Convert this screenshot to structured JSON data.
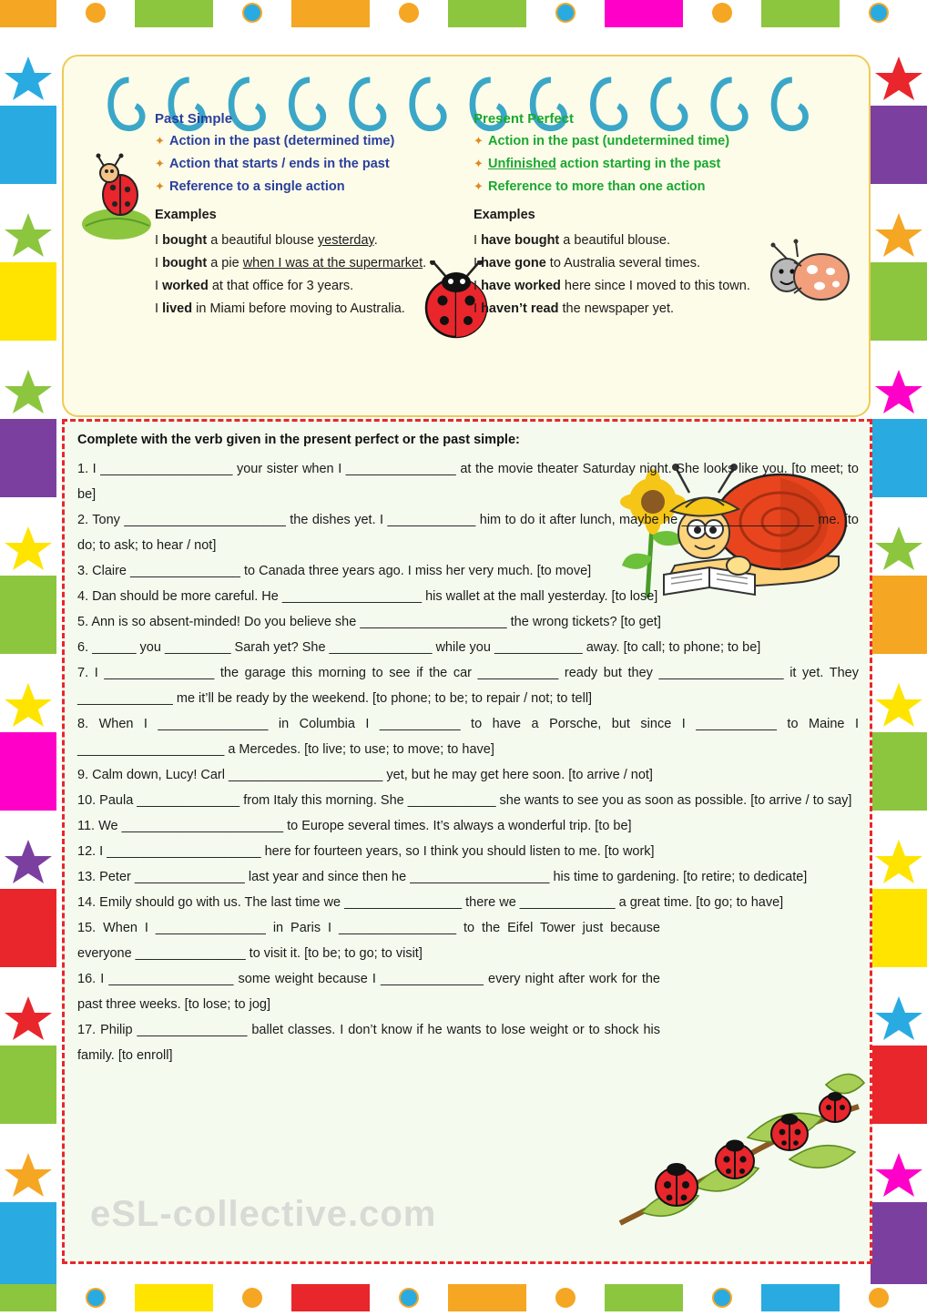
{
  "grammar": {
    "left": {
      "title": "Past Simple",
      "bullets": [
        "Action in the past (determined time)",
        "Action that starts / ends in the past",
        "Reference to a single action"
      ],
      "examples_title": "Examples",
      "examples": [
        {
          "pre": "I ",
          "bold": "bought",
          "post": " a beautiful blouse ",
          "underline": "yesterday",
          "tail": "."
        },
        {
          "pre": "I ",
          "bold": "bought",
          "post": " a pie ",
          "underline": "when I was at the supermarket",
          "tail": "."
        },
        {
          "pre": "I ",
          "bold": "worked",
          "post": " at that office for 3 years.",
          "underline": "",
          "tail": ""
        },
        {
          "pre": "I ",
          "bold": "lived",
          "post": " in Miami before moving to Australia.",
          "underline": "",
          "tail": ""
        }
      ]
    },
    "right": {
      "title": "Present Perfect",
      "bullets": [
        {
          "pre": "",
          "u": "",
          "post": "Action in the past (undetermined time)"
        },
        {
          "pre": "",
          "u": "Unfinished",
          "post": " action starting in the past"
        },
        {
          "pre": "",
          "u": "",
          "post": "Reference to more than one action"
        }
      ],
      "examples_title": "Examples",
      "examples": [
        {
          "pre": "I ",
          "bold": "have bought",
          "post": " a beautiful blouse."
        },
        {
          "pre": "I ",
          "bold": "have gone",
          "post": " to Australia several times."
        },
        {
          "pre": "I ",
          "bold": "have worked",
          "post": " here since I moved to this town."
        },
        {
          "pre": "I ",
          "bold": "haven’t read",
          "post": " the newspaper yet."
        }
      ]
    }
  },
  "exercise": {
    "instruction": "Complete with the verb given in the present perfect or the past simple:",
    "items": [
      "1. I __________________ your sister when I _______________ at the movie theater Saturday night. She looks like you. [to meet; to be]",
      "2. Tony ______________________ the dishes yet. I ____________ him to do it after lunch, maybe he __________________ me. [to do; to ask; to hear / not]",
      "3. Claire _______________ to Canada three years ago. I miss her very much. [to move]",
      "4. Dan should be more careful. He ___________________ his wallet at the mall yesterday. [to lose]",
      "5. Ann is so absent-minded! Do you believe she ____________________ the wrong tickets? [to get]",
      "6. ______ you _________ Sarah yet? She ______________ while you ____________ away. [to call; to phone; to be]",
      "7. I _______________ the garage this morning to see if the car ___________ ready but they _________________ it yet. They _____________ me it’ll be ready by the weekend. [to phone; to be; to repair / not; to tell]",
      "8. When I _______________ in Columbia I ___________ to have a Porsche, but since I ___________ to Maine I ____________________ a Mercedes. [to live; to use; to move; to have]",
      "9. Calm down, Lucy! Carl _____________________ yet, but he may get here soon. [to arrive / not]",
      "10. Paula ______________ from Italy this morning. She ____________ she wants to see you as soon as possible. [to arrive / to say]",
      "11. We ______________________ to Europe several times. It’s always a wonderful trip. [to be]",
      "12. I _____________________ here for fourteen years, so I think you should listen to me. [to work]",
      "13. Peter _______________ last year and since then he ___________________ his time to gardening. [to retire; to dedicate]",
      "14. Emily should go with us. The last time we ________________ there we _____________ a great time. [to go; to have]",
      "15. When I _______________ in Paris I ________________ to the Eifel Tower just because everyone _______________ to visit it. [to be; to go; to visit]",
      "16. I _________________ some weight because I ______________ every night after work for the past three weeks. [to lose; to jog]",
      "17. Philip _______________ ballet classes. I don’t know if he wants to lose weight or to shock his family. [to enroll]"
    ]
  },
  "watermark": "eSL-collective.com",
  "colors": {
    "past_simple": "#2a3f9d",
    "present_perfect": "#1aa832",
    "paper": "#fdfce8",
    "paper_border": "#f0ca55",
    "exercise_bg": "#f4fbee",
    "exercise_border": "#e8262c",
    "spiral": "#3aa7c8"
  },
  "decor": {
    "icons": [
      "ladybug",
      "ant",
      "beetle",
      "snail-reading",
      "ladybugs-on-branch",
      "sunflower"
    ]
  }
}
